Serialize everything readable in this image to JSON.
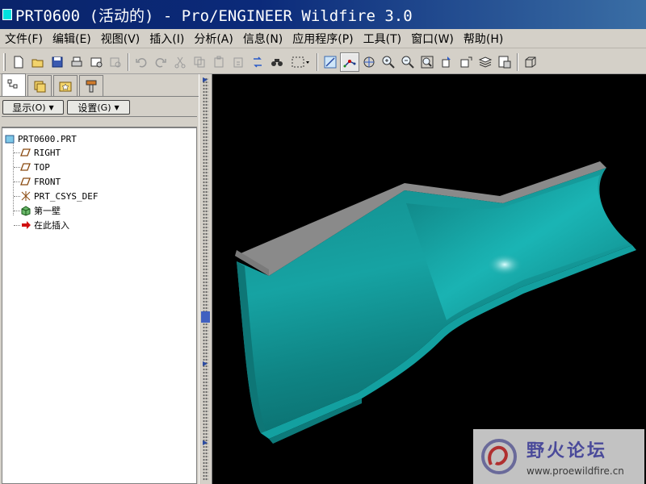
{
  "window": {
    "title": "PRT0600 (活动的) - Pro/ENGINEER Wildfire 3.0"
  },
  "menu": [
    {
      "label": "文件(F)",
      "name": "menu-file"
    },
    {
      "label": "编辑(E)",
      "name": "menu-edit"
    },
    {
      "label": "视图(V)",
      "name": "menu-view"
    },
    {
      "label": "插入(I)",
      "name": "menu-insert"
    },
    {
      "label": "分析(A)",
      "name": "menu-analysis"
    },
    {
      "label": "信息(N)",
      "name": "menu-info"
    },
    {
      "label": "应用程序(P)",
      "name": "menu-applications"
    },
    {
      "label": "工具(T)",
      "name": "menu-tools"
    },
    {
      "label": "窗口(W)",
      "name": "menu-window"
    },
    {
      "label": "帮助(H)",
      "name": "menu-help"
    }
  ],
  "nav": {
    "show_label": "显示",
    "show_key": "(O)",
    "settings_label": "设置",
    "settings_key": "(G)"
  },
  "tree": {
    "root": "PRT0600.PRT",
    "items": [
      {
        "label": "RIGHT",
        "icon": "datum-plane-icon"
      },
      {
        "label": "TOP",
        "icon": "datum-plane-icon"
      },
      {
        "label": "FRONT",
        "icon": "datum-plane-icon"
      },
      {
        "label": "PRT_CSYS_DEF",
        "icon": "coordinate-system-icon"
      },
      {
        "label": "第一壁",
        "icon": "sheetmetal-wall-icon"
      },
      {
        "label": "在此插入",
        "icon": "insert-here-arrow-icon"
      }
    ]
  },
  "watermark": {
    "title": "野火论坛",
    "url": "www.proewildfire.cn"
  },
  "colors": {
    "model": "#1aa6a6",
    "model_edge": "#8a8a8a",
    "viewport_bg": "#000000",
    "title_bar": "#0a246a"
  }
}
